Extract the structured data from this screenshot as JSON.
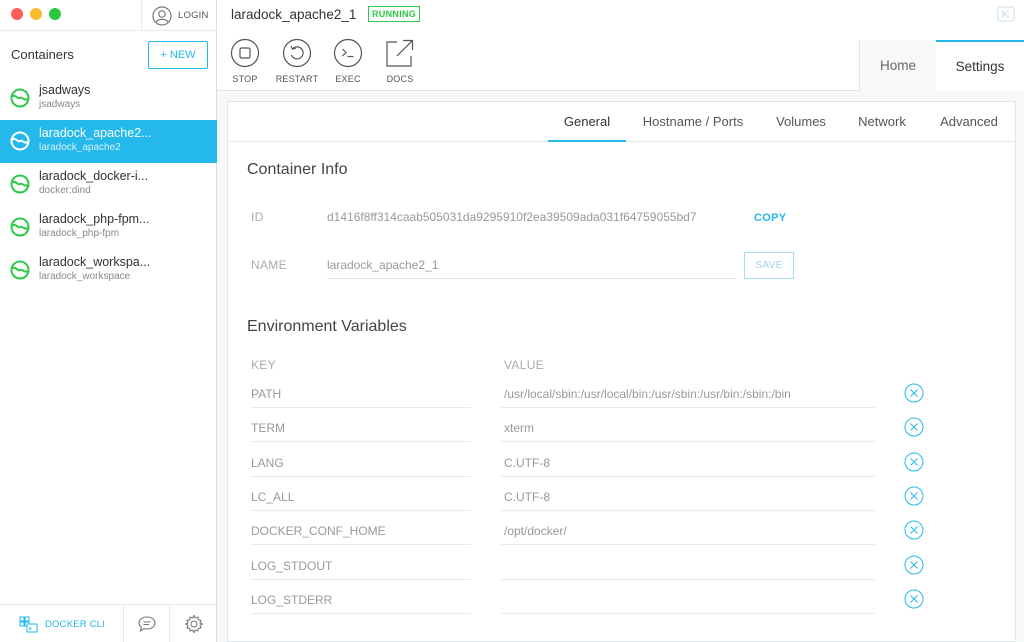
{
  "sidebar": {
    "login_label": "LOGIN",
    "containers_title": "Containers",
    "new_label": "+ NEW",
    "containers": [
      {
        "name": "jsadways",
        "image": "jsadways",
        "active": false
      },
      {
        "name": "laradock_apache2...",
        "image": "laradock_apache2",
        "active": true
      },
      {
        "name": "laradock_docker-i...",
        "image": "docker:dind",
        "active": false
      },
      {
        "name": "laradock_php-fpm...",
        "image": "laradock_php-fpm",
        "active": false
      },
      {
        "name": "laradock_workspa...",
        "image": "laradock_workspace",
        "active": false
      }
    ],
    "docker_cli_label": "DOCKER CLI"
  },
  "header": {
    "container_title": "laradock_apache2_1",
    "status": "RUNNING",
    "actions": [
      {
        "id": "stop",
        "label": "STOP"
      },
      {
        "id": "restart",
        "label": "RESTART"
      },
      {
        "id": "exec",
        "label": "EXEC"
      },
      {
        "id": "docs",
        "label": "DOCS"
      }
    ],
    "tabs": {
      "home": "Home",
      "settings": "Settings"
    }
  },
  "settings": {
    "subtabs": [
      "General",
      "Hostname / Ports",
      "Volumes",
      "Network",
      "Advanced"
    ],
    "container_info_title": "Container Info",
    "id_label": "ID",
    "id_value": "d1416f8ff314caab505031da9295910f2ea39509ada031f64759055bd7",
    "copy_label": "COPY",
    "name_label": "NAME",
    "name_value": "laradock_apache2_1",
    "save_label": "SAVE",
    "env_title": "Environment Variables",
    "env_key_header": "KEY",
    "env_value_header": "VALUE",
    "env": [
      {
        "key": "PATH",
        "value": "/usr/local/sbin:/usr/local/bin:/usr/sbin:/usr/bin:/sbin:/bin"
      },
      {
        "key": "TERM",
        "value": "xterm"
      },
      {
        "key": "LANG",
        "value": "C.UTF-8"
      },
      {
        "key": "LC_ALL",
        "value": "C.UTF-8"
      },
      {
        "key": "DOCKER_CONF_HOME",
        "value": "/opt/docker/"
      },
      {
        "key": "LOG_STDOUT",
        "value": ""
      },
      {
        "key": "LOG_STDERR",
        "value": ""
      }
    ]
  },
  "colors": {
    "accent": "#24b8eb",
    "running": "#2ec84a",
    "container_icon": "#2ec84a"
  }
}
